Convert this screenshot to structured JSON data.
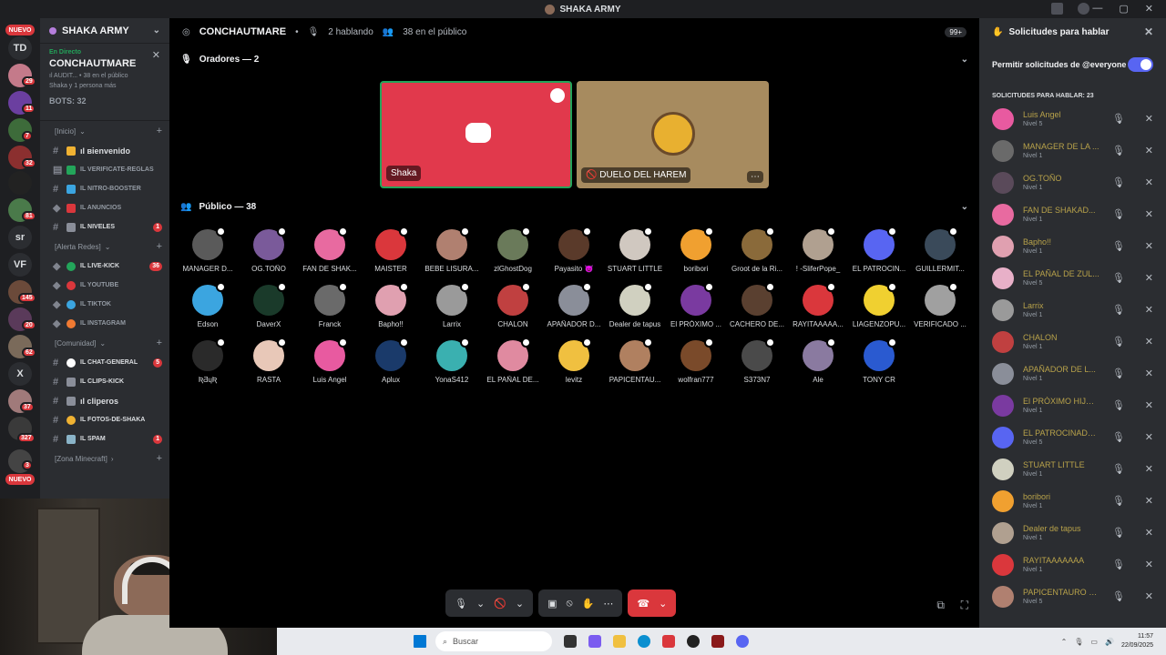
{
  "window": {
    "title": "SHAKA ARMY"
  },
  "rail": {
    "nuevo_top": "NUEVO",
    "nuevo_bottom": "NUEVO",
    "badges": [
      "29",
      "11",
      "7",
      "32",
      "81",
      "145",
      "20",
      "62",
      "37",
      "327",
      "3"
    ],
    "text_servers": [
      "TD",
      "sr",
      "VF",
      "X"
    ]
  },
  "server": {
    "name": "SHAKA ARMY"
  },
  "voice": {
    "status": "En Directo",
    "channel": "CONCHAUTMARE",
    "sub1": "ıl AUDIT... • 38 en el público",
    "sub2": "Shaka y 1 persona más",
    "bots": "BOTS: 32"
  },
  "categories": {
    "inicio": "[Inicio]",
    "alerta": "[Alerta Redes]",
    "comunidad": "[Comunidad]",
    "minecraft": "[Zona Minecraft]"
  },
  "channels": [
    {
      "name": "ıl віenvenido",
      "badge": ""
    },
    {
      "name": "ıl VERIFICATE-REGLAS",
      "badge": ""
    },
    {
      "name": "ıl NITRO-BOOSTER",
      "badge": ""
    },
    {
      "name": "ıl ANUNCIOS",
      "badge": ""
    },
    {
      "name": "ıl NIVELES",
      "badge": "1"
    },
    {
      "name": "ıl LIVE-KICK",
      "badge": "36"
    },
    {
      "name": "ıl YOUTUBE",
      "badge": ""
    },
    {
      "name": "ıl TIKTOK",
      "badge": ""
    },
    {
      "name": "ıl INSTAGRAM",
      "badge": ""
    },
    {
      "name": "ıl CHAT-GENERAL",
      "badge": "5"
    },
    {
      "name": "ıl CLIPS-KICK",
      "badge": ""
    },
    {
      "name": "ıl cliperos",
      "badge": ""
    },
    {
      "name": "ıl FOTOS-DE-SHAKA",
      "badge": ""
    },
    {
      "name": "ıl SPAM",
      "badge": "1"
    }
  ],
  "stage": {
    "channel": "CONCHAUTMARE",
    "speaking": "2 hablando",
    "audience": "38 en el público",
    "notif": "99+",
    "speakers_header": "Oradores — 2",
    "audience_header": "Público — 38",
    "speakers": [
      {
        "name": "Shaka"
      },
      {
        "name": "DUELO DEL HAREM"
      }
    ],
    "public": [
      "MANAGER D...",
      "OG.TOÑO",
      "FAN DE SHAK...",
      "MAISTER",
      "BEBE LISURA...",
      "zlGhostDog",
      "Payasito 👿",
      "STUART LITTLE",
      "boribori",
      "Groot de la Ri...",
      "! -SliferPope_",
      "EL PATROCIN...",
      "GUILLERMIT...",
      "Edson",
      "DaverX",
      "Franck",
      "Bapho!!",
      "Larrix",
      "CHALON",
      "APAÑADOR D...",
      "Dealer de tapus",
      "El PRÓXIMO ...",
      "CACHERO DE...",
      "RAYITAAAAA...",
      "LIAGENZOPU...",
      "VERIFICADO ...",
      "ƦƋɥƦ",
      "RASTA",
      "Luis Angel",
      "Aplux",
      "YonaS412",
      "EL PAÑAL DE...",
      "levitz",
      "PAPICENTAU...",
      "wolfran777",
      "S373N7",
      "Ale",
      "TONY CR"
    ]
  },
  "requests": {
    "title": "Solicitudes para hablar",
    "allow_label": "Permitir solicitudes de @everyone",
    "count_label": "SOLICITUDES PARA HABLAR: 23",
    "items": [
      {
        "name": "Luis Angel",
        "level": "Nivel 5"
      },
      {
        "name": "MANAGER DE LA ...",
        "level": "Nivel 1"
      },
      {
        "name": "OG.TOÑO",
        "level": "Nivel 1"
      },
      {
        "name": "FAN DE SHAKAD...",
        "level": "Nivel 1"
      },
      {
        "name": "Bapho!!",
        "level": "Nivel 1"
      },
      {
        "name": "EL PAÑAL DE ZUL...",
        "level": "Nivel 5"
      },
      {
        "name": "Larrix",
        "level": "Nivel 1"
      },
      {
        "name": "CHALON",
        "level": "Nivel 1"
      },
      {
        "name": "APAÑADOR DE L...",
        "level": "Nivel 1"
      },
      {
        "name": "El PRÓXIMO HIJO ...",
        "level": "Nivel 1"
      },
      {
        "name": "EL PATROCINADO...",
        "level": "Nivel 5"
      },
      {
        "name": "STUART LITTLE",
        "level": "Nivel 1"
      },
      {
        "name": "boribori",
        "level": "Nivel 1"
      },
      {
        "name": "Dealer de tapus",
        "level": "Nivel 1"
      },
      {
        "name": "RAYITAAAAAAA",
        "level": "Nivel 1"
      },
      {
        "name": "PAPICENTAURO C...",
        "level": "Nivel 5"
      }
    ]
  },
  "taskbar": {
    "search_placeholder": "Buscar",
    "time": "11:57",
    "date": "22/09/2025"
  },
  "colors": {
    "accent": "#5865f2",
    "danger": "#da373c",
    "online": "#23a55a",
    "request_name": "#b8a24a",
    "speaker_tile_1": "#e1394c",
    "speaker_tile_2": "#a78b5f"
  }
}
